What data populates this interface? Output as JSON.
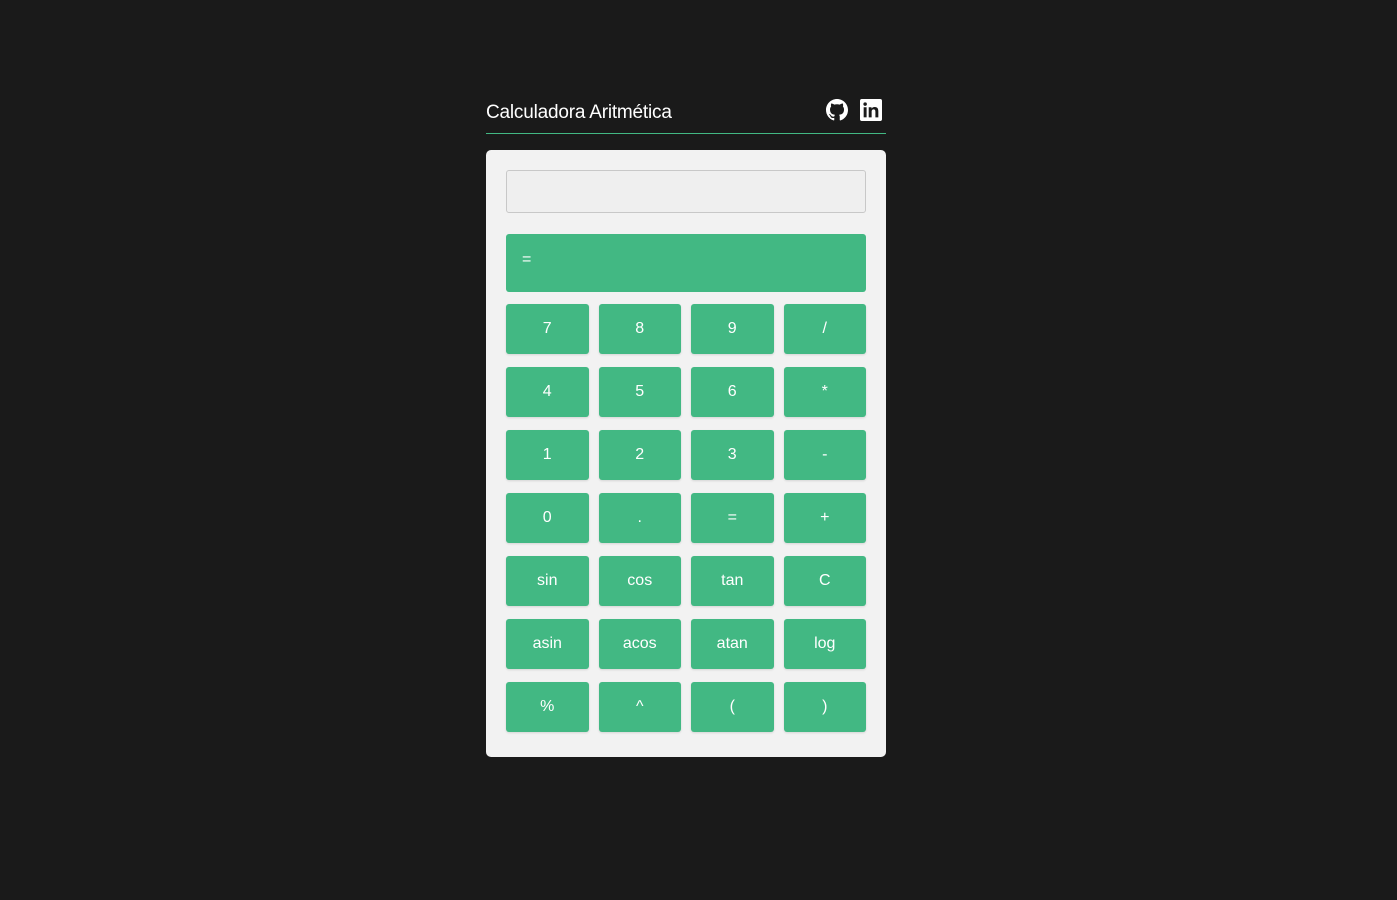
{
  "header": {
    "title": "Calculadora Aritmética",
    "icons": [
      "github-icon",
      "linkedin-icon"
    ]
  },
  "display": {
    "value": "",
    "placeholder": ""
  },
  "result": {
    "label": "="
  },
  "keys": [
    {
      "label": "7",
      "name": "key-7"
    },
    {
      "label": "8",
      "name": "key-8"
    },
    {
      "label": "9",
      "name": "key-9"
    },
    {
      "label": "/",
      "name": "key-divide"
    },
    {
      "label": "4",
      "name": "key-4"
    },
    {
      "label": "5",
      "name": "key-5"
    },
    {
      "label": "6",
      "name": "key-6"
    },
    {
      "label": "*",
      "name": "key-multiply"
    },
    {
      "label": "1",
      "name": "key-1"
    },
    {
      "label": "2",
      "name": "key-2"
    },
    {
      "label": "3",
      "name": "key-3"
    },
    {
      "label": "-",
      "name": "key-subtract"
    },
    {
      "label": "0",
      "name": "key-0"
    },
    {
      "label": ".",
      "name": "key-decimal"
    },
    {
      "label": "=",
      "name": "key-equals"
    },
    {
      "label": "+",
      "name": "key-add"
    },
    {
      "label": "sin",
      "name": "key-sin"
    },
    {
      "label": "cos",
      "name": "key-cos"
    },
    {
      "label": "tan",
      "name": "key-tan"
    },
    {
      "label": "C",
      "name": "key-clear"
    },
    {
      "label": "asin",
      "name": "key-asin"
    },
    {
      "label": "acos",
      "name": "key-acos"
    },
    {
      "label": "atan",
      "name": "key-atan"
    },
    {
      "label": "log",
      "name": "key-log"
    },
    {
      "label": "%",
      "name": "key-percent"
    },
    {
      "label": "^",
      "name": "key-power"
    },
    {
      "label": "(",
      "name": "key-open-paren"
    },
    {
      "label": ")",
      "name": "key-close-paren"
    }
  ],
  "colors": {
    "background": "#1a1a1a",
    "accent": "#42b883",
    "panel": "#f2f2f2",
    "text_light": "#ffffff"
  }
}
